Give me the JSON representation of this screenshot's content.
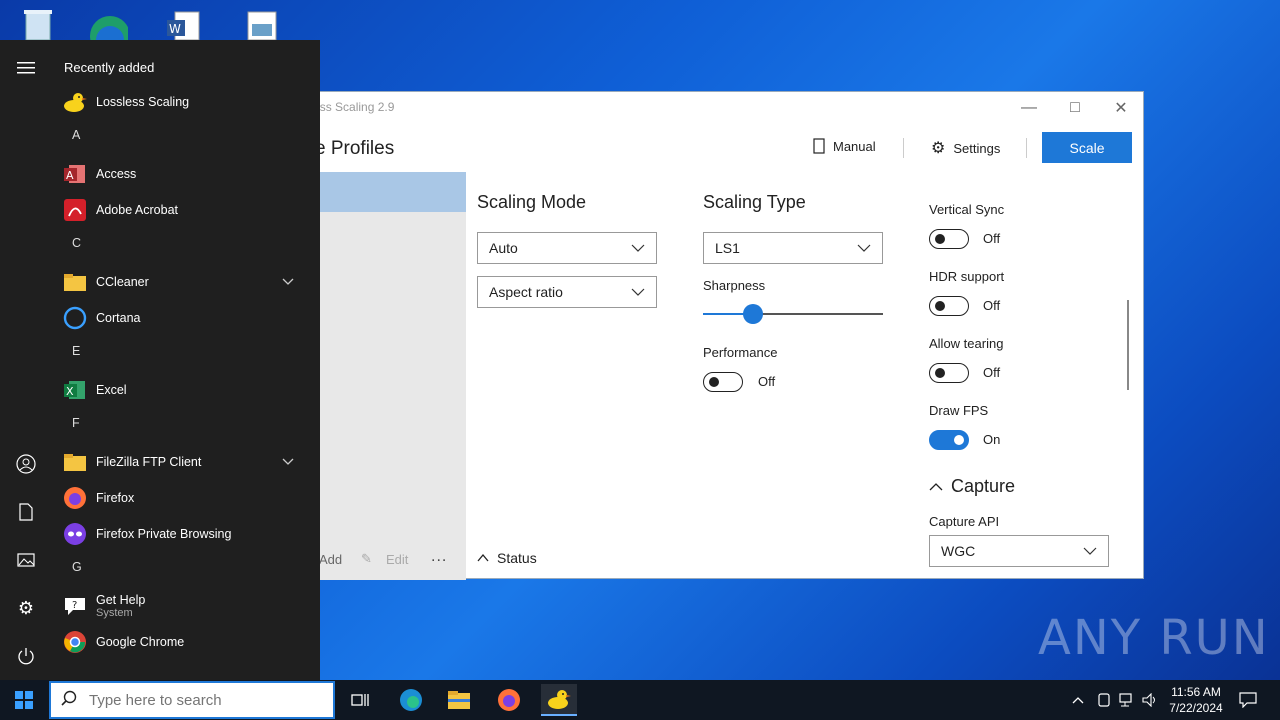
{
  "watermark": "ANY RUN",
  "window": {
    "title": "Lossless Scaling 2.9",
    "header_title": "e Profiles",
    "manual_label": "Manual",
    "settings_label": "Settings",
    "scale_label": "Scale",
    "left_footer": {
      "add_label": "Add",
      "edit_label": "Edit",
      "more_label": "..."
    },
    "scaling_mode": {
      "heading": "Scaling Mode",
      "mode_value": "Auto",
      "aspect_value": "Aspect ratio"
    },
    "scaling_type": {
      "heading": "Scaling Type",
      "type_value": "LS1",
      "sharpness_label": "Sharpness",
      "sharpness_level": 0.28,
      "performance_label": "Performance",
      "performance_state": "Off"
    },
    "rendering": {
      "vsync_label": "Vertical Sync",
      "vsync_state": "Off",
      "hdr_label": "HDR support",
      "hdr_state": "Off",
      "tearing_label": "Allow tearing",
      "tearing_state": "Off",
      "fps_label": "Draw FPS",
      "fps_state": "On"
    },
    "capture": {
      "heading": "Capture",
      "api_label": "Capture API",
      "api_value": "WGC"
    },
    "status_label": "Status"
  },
  "start_menu": {
    "recently_added": "Recently added",
    "items": [
      {
        "type": "app",
        "label": "Lossless Scaling",
        "icon": "duck-icon"
      },
      {
        "type": "letter",
        "label": "A"
      },
      {
        "type": "app",
        "label": "Access",
        "icon": "access-icon"
      },
      {
        "type": "app",
        "label": "Adobe Acrobat",
        "icon": "acrobat-icon"
      },
      {
        "type": "letter",
        "label": "C"
      },
      {
        "type": "folder",
        "label": "CCleaner",
        "icon": "folder-icon"
      },
      {
        "type": "app",
        "label": "Cortana",
        "icon": "cortana-icon"
      },
      {
        "type": "letter",
        "label": "E"
      },
      {
        "type": "app",
        "label": "Excel",
        "icon": "excel-icon"
      },
      {
        "type": "letter",
        "label": "F"
      },
      {
        "type": "folder",
        "label": "FileZilla FTP Client",
        "icon": "folder-icon"
      },
      {
        "type": "app",
        "label": "Firefox",
        "icon": "firefox-icon"
      },
      {
        "type": "app",
        "label": "Firefox Private Browsing",
        "icon": "private-browsing-icon"
      },
      {
        "type": "letter",
        "label": "G"
      },
      {
        "type": "app",
        "label": "Get Help",
        "sub": "System",
        "icon": "get-help-icon"
      },
      {
        "type": "app",
        "label": "Google Chrome",
        "icon": "chrome-icon"
      }
    ]
  },
  "taskbar": {
    "search_placeholder": "Type here to search",
    "time": "11:56 AM",
    "date": "7/22/2024"
  }
}
